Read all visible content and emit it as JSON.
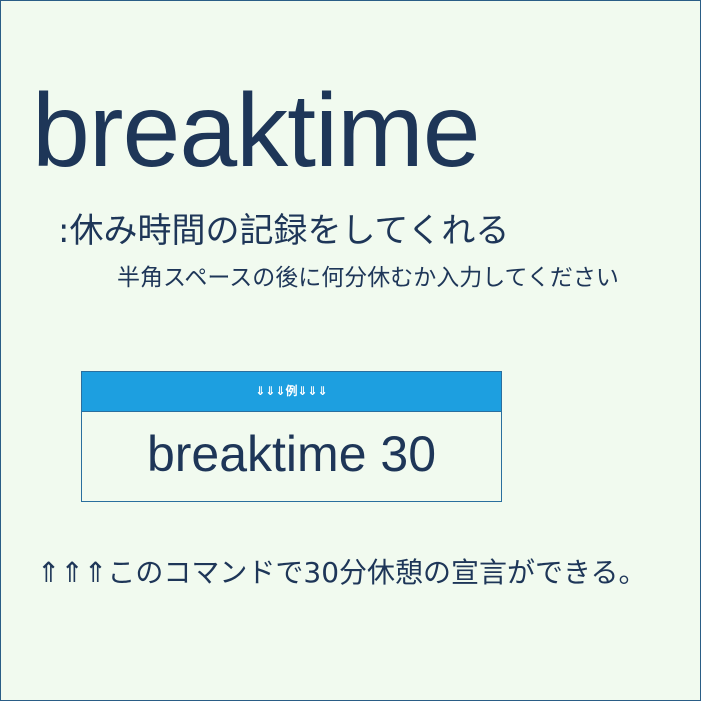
{
  "title": "breaktime",
  "subtitle": ":休み時間の記録をしてくれる",
  "instruction": "半角スペースの後に何分休むか入力してください",
  "example": {
    "header": "⇓⇓⇓例⇓⇓⇓",
    "command": "breaktime 30"
  },
  "footer_note": "⇑⇑⇑このコマンドで30分休憩の宣言ができる。",
  "colors": {
    "background": "#f1faef",
    "text": "#1e3658",
    "header_bar": "#1d9fe0",
    "border": "#2a6f9e"
  }
}
